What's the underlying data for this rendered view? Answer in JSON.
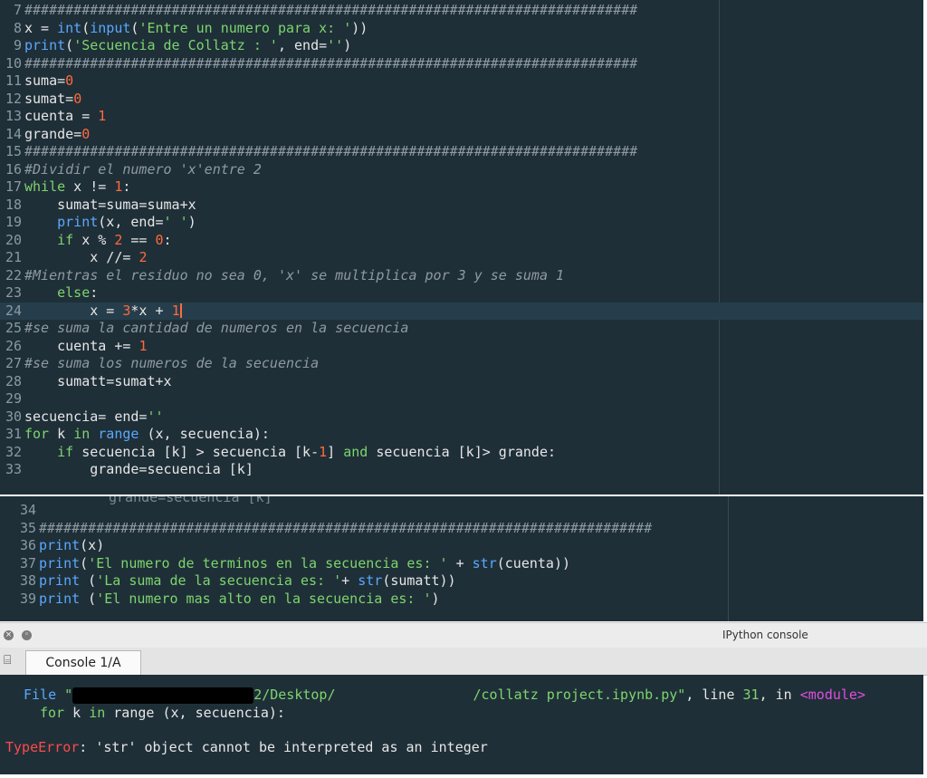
{
  "editor_top": {
    "lines": [
      {
        "n": "7",
        "segs": [
          {
            "c": "cm",
            "t": "###########################################################################"
          }
        ]
      },
      {
        "n": "8",
        "segs": [
          {
            "c": "op",
            "t": "x = "
          },
          {
            "c": "fn",
            "t": "int"
          },
          {
            "c": "op",
            "t": "("
          },
          {
            "c": "fn",
            "t": "input"
          },
          {
            "c": "op",
            "t": "("
          },
          {
            "c": "st",
            "t": "'Entre un numero para x: '"
          },
          {
            "c": "op",
            "t": "))"
          }
        ]
      },
      {
        "n": "9",
        "segs": [
          {
            "c": "fn",
            "t": "print"
          },
          {
            "c": "op",
            "t": "("
          },
          {
            "c": "st",
            "t": "'Secuencia de Collatz : '"
          },
          {
            "c": "op",
            "t": ", end="
          },
          {
            "c": "st",
            "t": "''"
          },
          {
            "c": "op",
            "t": ")"
          }
        ]
      },
      {
        "n": "10",
        "segs": [
          {
            "c": "cm",
            "t": "###########################################################################"
          }
        ]
      },
      {
        "n": "11",
        "segs": [
          {
            "c": "op",
            "t": "suma="
          },
          {
            "c": "nm",
            "t": "0"
          }
        ]
      },
      {
        "n": "12",
        "segs": [
          {
            "c": "op",
            "t": "sumat="
          },
          {
            "c": "nm",
            "t": "0"
          }
        ]
      },
      {
        "n": "13",
        "segs": [
          {
            "c": "op",
            "t": "cuenta = "
          },
          {
            "c": "nm",
            "t": "1"
          }
        ]
      },
      {
        "n": "14",
        "segs": [
          {
            "c": "op",
            "t": "grande="
          },
          {
            "c": "nm",
            "t": "0"
          }
        ]
      },
      {
        "n": "15",
        "segs": [
          {
            "c": "cm",
            "t": "###########################################################################"
          }
        ]
      },
      {
        "n": "16",
        "segs": [
          {
            "c": "cm",
            "t": "#Dividir el numero 'x'entre 2"
          }
        ]
      },
      {
        "n": "17",
        "segs": [
          {
            "c": "kw",
            "t": "while"
          },
          {
            "c": "op",
            "t": " x != "
          },
          {
            "c": "nm",
            "t": "1"
          },
          {
            "c": "op",
            "t": ":"
          }
        ]
      },
      {
        "n": "18",
        "segs": [
          {
            "c": "op",
            "t": "    sumat=suma=suma+x"
          }
        ]
      },
      {
        "n": "19",
        "segs": [
          {
            "c": "op",
            "t": "    "
          },
          {
            "c": "fn",
            "t": "print"
          },
          {
            "c": "op",
            "t": "(x, end="
          },
          {
            "c": "st",
            "t": "' '"
          },
          {
            "c": "op",
            "t": ")"
          }
        ]
      },
      {
        "n": "20",
        "segs": [
          {
            "c": "op",
            "t": "    "
          },
          {
            "c": "kw",
            "t": "if"
          },
          {
            "c": "op",
            "t": " x % "
          },
          {
            "c": "nm",
            "t": "2"
          },
          {
            "c": "op",
            "t": " == "
          },
          {
            "c": "nm",
            "t": "0"
          },
          {
            "c": "op",
            "t": ":"
          }
        ]
      },
      {
        "n": "21",
        "segs": [
          {
            "c": "op",
            "t": "        x //= "
          },
          {
            "c": "nm",
            "t": "2"
          }
        ]
      },
      {
        "n": "22",
        "segs": [
          {
            "c": "cm",
            "t": "#Mientras el residuo no sea 0, 'x' se multiplica por 3 y se suma 1"
          }
        ]
      },
      {
        "n": "23",
        "segs": [
          {
            "c": "op",
            "t": "    "
          },
          {
            "c": "kw",
            "t": "else"
          },
          {
            "c": "op",
            "t": ":"
          }
        ]
      },
      {
        "n": "24",
        "segs": [
          {
            "c": "op",
            "t": "        x = "
          },
          {
            "c": "nm",
            "t": "3"
          },
          {
            "c": "op",
            "t": "*x + "
          },
          {
            "c": "nm",
            "t": "1"
          }
        ],
        "current": true
      },
      {
        "n": "25",
        "segs": [
          {
            "c": "cm",
            "t": "#se suma la cantidad de numeros en la secuencia"
          }
        ]
      },
      {
        "n": "26",
        "segs": [
          {
            "c": "op",
            "t": "    cuenta += "
          },
          {
            "c": "nm",
            "t": "1"
          }
        ]
      },
      {
        "n": "27",
        "segs": [
          {
            "c": "cm",
            "t": "#se suma los numeros de la secuencia"
          }
        ]
      },
      {
        "n": "28",
        "segs": [
          {
            "c": "op",
            "t": "    sumatt=sumat+x"
          }
        ]
      },
      {
        "n": "29",
        "segs": []
      },
      {
        "n": "30",
        "segs": [
          {
            "c": "op",
            "t": "secuencia= end="
          },
          {
            "c": "st",
            "t": "''"
          }
        ]
      },
      {
        "n": "31",
        "segs": [
          {
            "c": "kw",
            "t": "for"
          },
          {
            "c": "op",
            "t": " k "
          },
          {
            "c": "kw",
            "t": "in"
          },
          {
            "c": "op",
            "t": " "
          },
          {
            "c": "fn",
            "t": "range"
          },
          {
            "c": "op",
            "t": " (x, secuencia):"
          }
        ]
      },
      {
        "n": "32",
        "segs": [
          {
            "c": "op",
            "t": "    "
          },
          {
            "c": "kw",
            "t": "if"
          },
          {
            "c": "op",
            "t": " secuencia [k] > secuencia [k-"
          },
          {
            "c": "nm",
            "t": "1"
          },
          {
            "c": "op",
            "t": "] "
          },
          {
            "c": "kw",
            "t": "and"
          },
          {
            "c": "op",
            "t": " secuencia [k]> grande:"
          }
        ]
      },
      {
        "n": "33",
        "segs": [
          {
            "c": "op",
            "t": "        grande=secuencia [k]"
          }
        ]
      }
    ]
  },
  "editor_bottom": {
    "lines": [
      {
        "n": "34",
        "segs": []
      },
      {
        "n": "35",
        "segs": [
          {
            "c": "cm",
            "t": "###########################################################################"
          }
        ]
      },
      {
        "n": "36",
        "segs": [
          {
            "c": "fn",
            "t": "print"
          },
          {
            "c": "op",
            "t": "(x)"
          }
        ]
      },
      {
        "n": "37",
        "segs": [
          {
            "c": "fn",
            "t": "print"
          },
          {
            "c": "op",
            "t": "("
          },
          {
            "c": "st",
            "t": "'El numero de terminos en la secuencia es: '"
          },
          {
            "c": "op",
            "t": " + "
          },
          {
            "c": "fn",
            "t": "str"
          },
          {
            "c": "op",
            "t": "(cuenta))"
          }
        ]
      },
      {
        "n": "38",
        "segs": [
          {
            "c": "fn",
            "t": "print"
          },
          {
            "c": "op",
            "t": " ("
          },
          {
            "c": "st",
            "t": "'La suma de la secuencia es: '"
          },
          {
            "c": "op",
            "t": "+ "
          },
          {
            "c": "fn",
            "t": "str"
          },
          {
            "c": "op",
            "t": "(sumatt))"
          }
        ]
      },
      {
        "n": "39",
        "segs": [
          {
            "c": "fn",
            "t": "print"
          },
          {
            "c": "op",
            "t": " ("
          },
          {
            "c": "st",
            "t": "'El numero mas alto en la secuencia es: '"
          },
          {
            "c": "op",
            "t": ")"
          }
        ]
      }
    ]
  },
  "console_window": {
    "title": "IPython console",
    "tab_label": "Console 1/A"
  },
  "console_output": {
    "file_label": "File",
    "quote_open": "\"",
    "path_mid": "2/Desktop/",
    "path_end": "/collatz project.ipynb.py\"",
    "sep1": ", line ",
    "line_no": "31",
    "sep2": ", in ",
    "module": "<module>",
    "code_line": "for k in range (x, secuencia):",
    "error_type": "TypeError",
    "error_msg": ": 'str' object cannot be interpreted as an integer"
  }
}
